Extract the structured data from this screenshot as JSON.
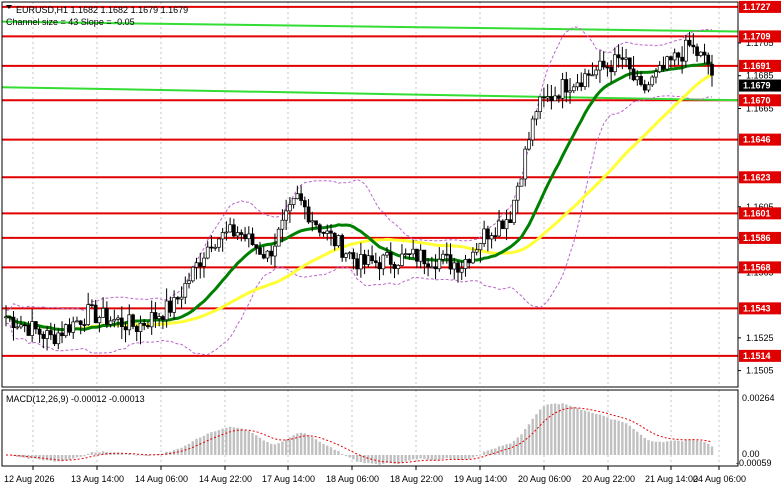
{
  "header": {
    "symbol_line": "EURUSD,H1  1.1682 1.1682 1.1679 1.1679",
    "channel_line": "Channel size = 43 Slope = -0.05"
  },
  "macd": {
    "label": "MACD(12,26,9) -0.00012 -0.00013",
    "scale_top": "0.00264",
    "scale_zero": "0.00",
    "scale_bottom": "-0.00059"
  },
  "colors": {
    "level": "#e00000",
    "channel": "#33dd33",
    "ma_fast": "#008000",
    "ma_slow": "#ffff33",
    "bollinger": "#bb66cc",
    "candle": "#000000",
    "macd_hist": "#c0c0c0",
    "macd_signal": "#e00000",
    "grid": "#a0a0a0"
  },
  "chart_data": {
    "type": "candlestick",
    "y_range": [
      1.1495,
      1.173
    ],
    "price_ticks": [
      "1.1705",
      "1.1685",
      "1.1665",
      "1.1605",
      "1.1585",
      "1.1565",
      "1.1525",
      "1.1505"
    ],
    "levels": [
      {
        "label": "1.1727",
        "value": 1.1727
      },
      {
        "label": "1.1709",
        "value": 1.1709
      },
      {
        "label": "1.1691",
        "value": 1.1691
      },
      {
        "label": "1.1670",
        "value": 1.167
      },
      {
        "label": "1.1646",
        "value": 1.1646
      },
      {
        "label": "1.1623",
        "value": 1.1623
      },
      {
        "label": "1.1601",
        "value": 1.1601
      },
      {
        "label": "1.1586",
        "value": 1.1586
      },
      {
        "label": "1.1568",
        "value": 1.1568
      },
      {
        "label": "1.1543",
        "value": 1.1543
      },
      {
        "label": "1.1514",
        "value": 1.1514
      }
    ],
    "current_price": {
      "label": "1.1679",
      "value": 1.1679
    },
    "x_labels": [
      "12 Aug 2026",
      "13 Aug 14:00",
      "14 Aug 06:00",
      "14 Aug 22:00",
      "17 Aug 14:00",
      "18 Aug 06:00",
      "18 Aug 22:00",
      "19 Aug 14:00",
      "20 Aug 06:00",
      "20 Aug 22:00",
      "21 Aug 14:00",
      "24 Aug 06:00"
    ],
    "channel_lines": [
      {
        "name": "upper",
        "start": 1.1718,
        "end": 1.1712
      },
      {
        "name": "lower",
        "start": 1.1678,
        "end": 1.167
      }
    ]
  }
}
